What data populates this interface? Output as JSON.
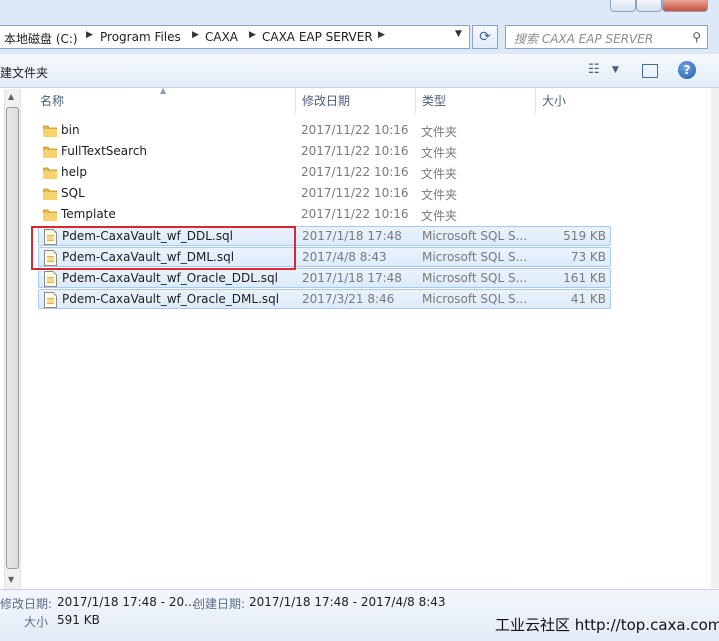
{
  "address": {
    "crumbs": [
      "本地磁盘 (C:)",
      "Program Files",
      "CAXA",
      "CAXA EAP SERVER"
    ]
  },
  "search": {
    "placeholder": "搜索 CAXA EAP SERVER"
  },
  "toolbar": {
    "new_folder_label": "建文件夹"
  },
  "columns": {
    "name": "名称",
    "date": "修改日期",
    "type": "类型",
    "size": "大小"
  },
  "files": [
    {
      "icon": "folder-icon",
      "name": "bin",
      "date": "2017/11/22 10:16",
      "type": "文件夹",
      "size": ""
    },
    {
      "icon": "folder-icon",
      "name": "FullTextSearch",
      "date": "2017/11/22 10:16",
      "type": "文件夹",
      "size": ""
    },
    {
      "icon": "folder-icon",
      "name": "help",
      "date": "2017/11/22 10:16",
      "type": "文件夹",
      "size": ""
    },
    {
      "icon": "folder-icon",
      "name": "SQL",
      "date": "2017/11/22 10:16",
      "type": "文件夹",
      "size": ""
    },
    {
      "icon": "folder-icon",
      "name": "Template",
      "date": "2017/11/22 10:16",
      "type": "文件夹",
      "size": ""
    },
    {
      "icon": "sql-file-icon",
      "name": "Pdem-CaxaVault_wf_DDL.sql",
      "date": "2017/1/18 17:48",
      "type": "Microsoft SQL S...",
      "size": "519 KB",
      "selected": true
    },
    {
      "icon": "sql-file-icon",
      "name": "Pdem-CaxaVault_wf_DML.sql",
      "date": "2017/4/8 8:43",
      "type": "Microsoft SQL S...",
      "size": "73 KB",
      "selected": true
    },
    {
      "icon": "sql-file-icon",
      "name": "Pdem-CaxaVault_wf_Oracle_DDL.sql",
      "date": "2017/1/18 17:48",
      "type": "Microsoft SQL S...",
      "size": "161 KB",
      "selected": true
    },
    {
      "icon": "sql-file-icon",
      "name": "Pdem-CaxaVault_wf_Oracle_DML.sql",
      "date": "2017/3/21 8:46",
      "type": "Microsoft SQL S...",
      "size": "41 KB",
      "selected": true
    }
  ],
  "details": {
    "modified_label": "修改日期:",
    "modified_value": "2017/1/18 17:48 - 20...",
    "created_label": "创建日期:",
    "created_value": "2017/1/18 17:48 - 2017/4/8 8:43",
    "size_label": "大小",
    "size_value": "591 KB"
  },
  "watermark": "工业云社区 http://top.caxa.com/",
  "colors": {
    "highlight": "#d9272e",
    "selection": "#dcebfb",
    "chrome": "#dde9f7"
  }
}
